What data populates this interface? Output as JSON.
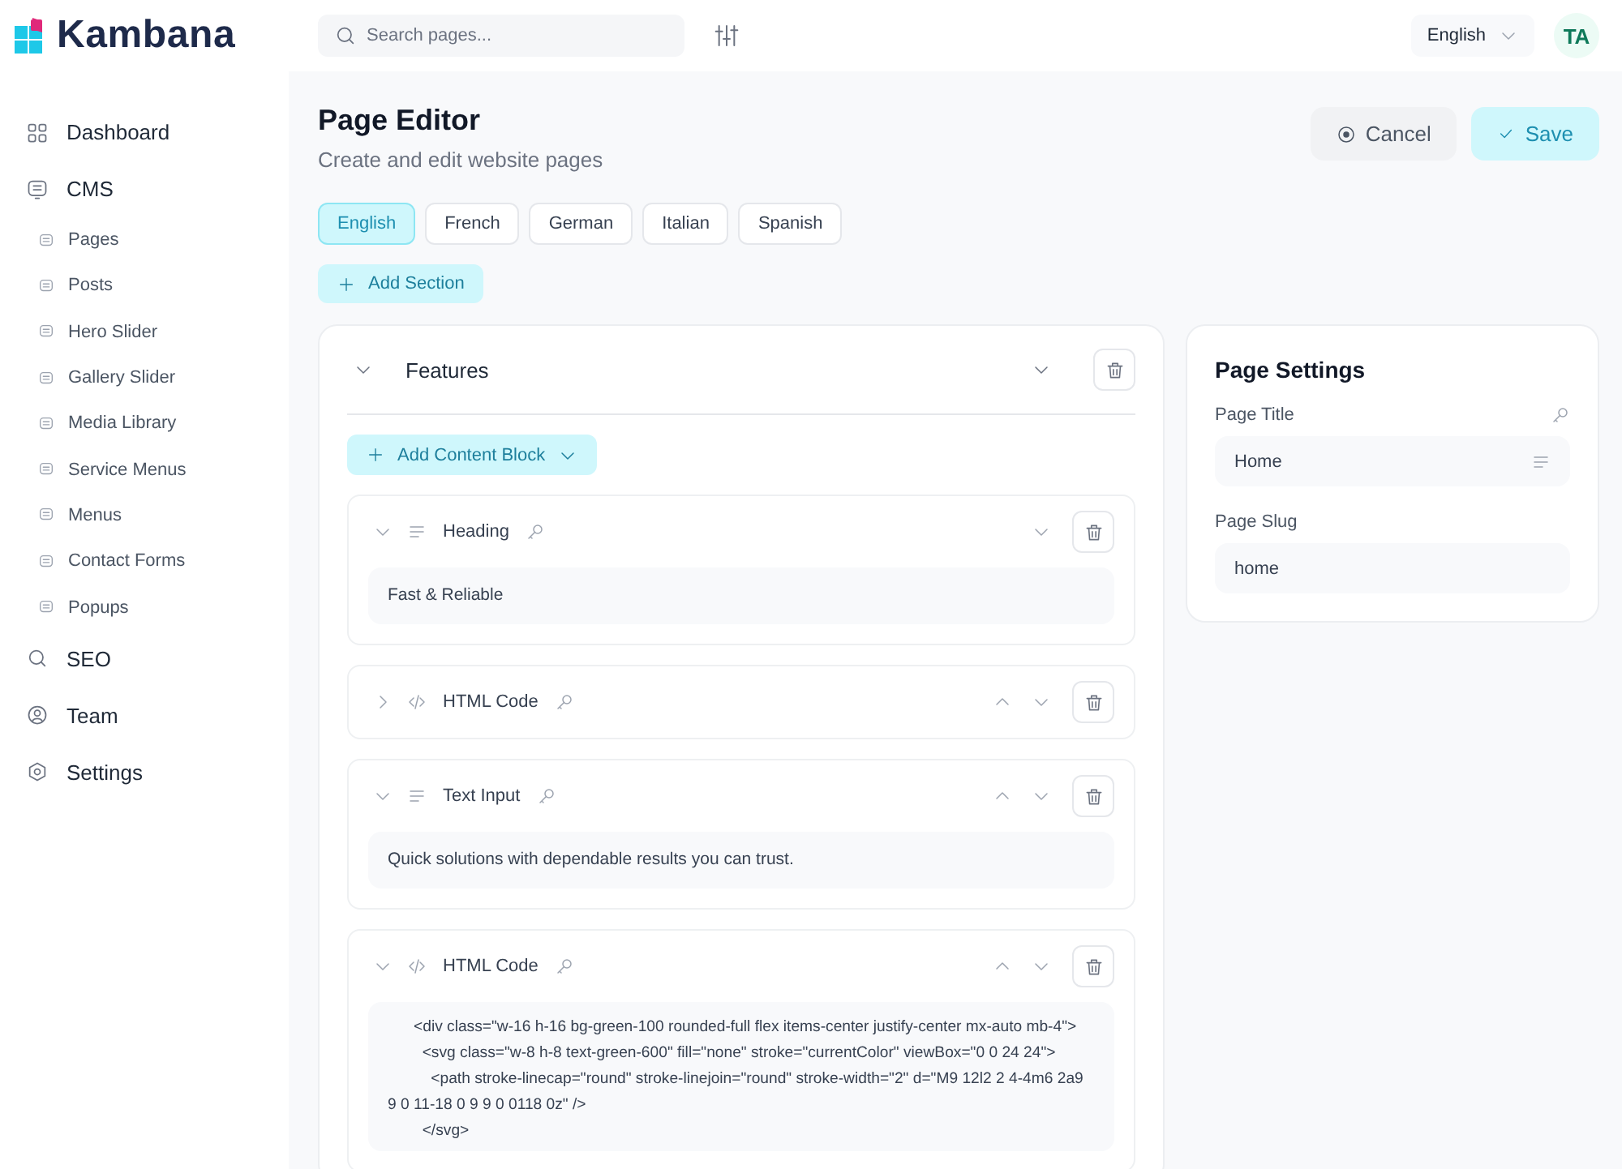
{
  "brand": {
    "name": "Kambana"
  },
  "search": {
    "placeholder": "Search pages..."
  },
  "language_menu": {
    "value": "English"
  },
  "user": {
    "initials": "TA"
  },
  "sidebar": {
    "items": [
      {
        "label": "Dashboard"
      },
      {
        "label": "CMS",
        "children": [
          {
            "label": "Pages"
          },
          {
            "label": "Posts"
          },
          {
            "label": "Hero Slider"
          },
          {
            "label": "Gallery Slider"
          },
          {
            "label": "Media Library"
          },
          {
            "label": "Service Menus"
          },
          {
            "label": "Menus"
          },
          {
            "label": "Contact Forms"
          },
          {
            "label": "Popups"
          }
        ]
      },
      {
        "label": "SEO"
      },
      {
        "label": "Team"
      },
      {
        "label": "Settings"
      }
    ]
  },
  "page": {
    "title": "Page Editor",
    "subtitle": "Create and edit website pages"
  },
  "actions": {
    "cancel": "Cancel",
    "save": "Save"
  },
  "language_tabs": [
    {
      "label": "English",
      "selected": true
    },
    {
      "label": "French",
      "selected": false
    },
    {
      "label": "German",
      "selected": false
    },
    {
      "label": "Italian",
      "selected": false
    },
    {
      "label": "Spanish",
      "selected": false
    }
  ],
  "add_section": "Add Section",
  "section": {
    "title": "Features",
    "expanded": true,
    "add_block": "Add Content Block",
    "blocks": [
      {
        "kind": "text",
        "label": "Heading",
        "expanded": true,
        "content": [
          "Fast & Reliable"
        ]
      },
      {
        "kind": "code",
        "label": "HTML Code",
        "expanded": false
      },
      {
        "kind": "text",
        "label": "Text Input",
        "expanded": true,
        "content": [
          "Quick solutions with dependable results you can trust."
        ]
      },
      {
        "kind": "code",
        "label": "HTML Code",
        "expanded": true,
        "content": [
          "      <div class=\"w-16 h-16 bg-green-100 rounded-full flex items-center justify-center mx-auto mb-4\">",
          "        <svg class=\"w-8 h-8 text-green-600\" fill=\"none\" stroke=\"currentColor\" viewBox=\"0 0 24 24\">",
          "          <path stroke-linecap=\"round\" stroke-linejoin=\"round\" stroke-width=\"2\" d=\"M9 12l2 2 4-4m6 2a9 9 0 11-18 0 9 9 0 0118 0z\" />",
          "        </svg>"
        ]
      }
    ]
  },
  "page_settings": {
    "title": "Page Settings",
    "fields": [
      {
        "label": "Page Title",
        "value": "Home",
        "kind": "title"
      },
      {
        "label": "Page Slug",
        "value": "home",
        "kind": "slug"
      }
    ]
  }
}
